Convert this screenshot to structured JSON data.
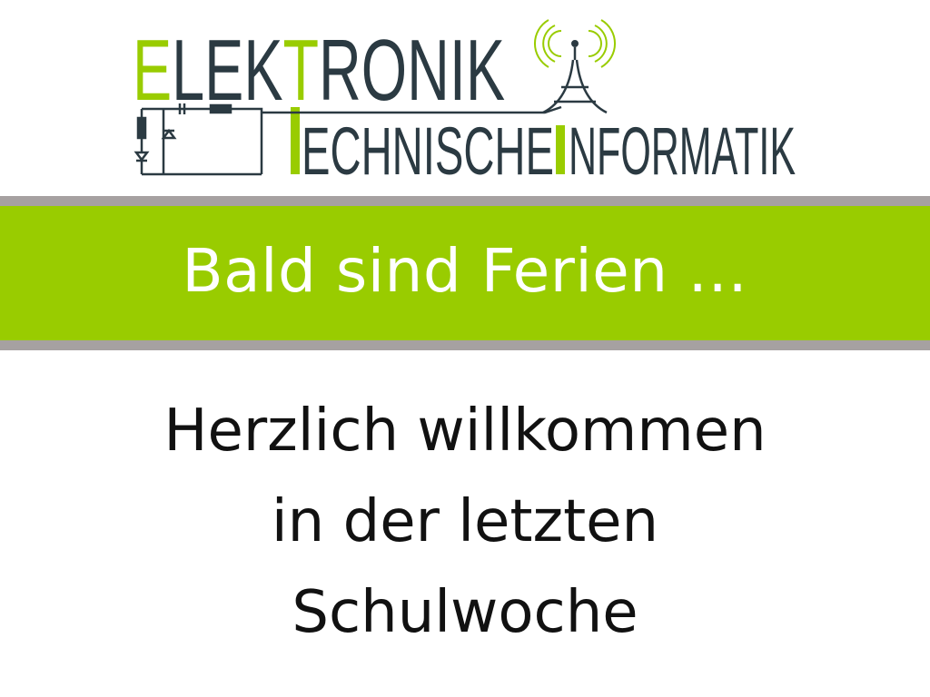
{
  "logo": {
    "line1": {
      "first": "E",
      "mid": "LEK",
      "accent": "T",
      "rest": "RONIK"
    },
    "line2": {
      "part1": "ECHNISCHE",
      "accent": "I",
      "part2": "NFORMATIK"
    },
    "icon": "radio-tower-icon",
    "circuit_icon": "circuit-diagram-icon"
  },
  "banner": {
    "text": "Bald sind Ferien …"
  },
  "welcome": {
    "line1": "Herzlich willkommen",
    "line2": "in der letzten",
    "line3": "Schulwoche"
  },
  "colors": {
    "accent_green": "#99cc00",
    "logo_dark": "#2b3a42",
    "band_grey": "#a6a1a1",
    "text_black": "#111111"
  }
}
